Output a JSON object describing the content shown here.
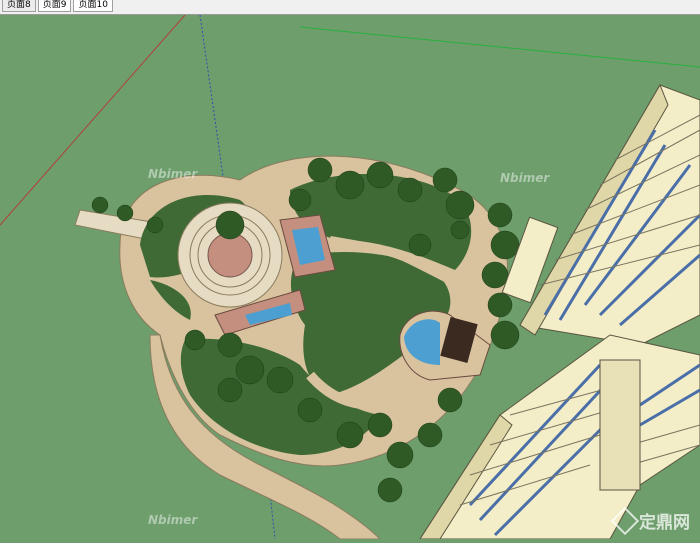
{
  "tabs": [
    {
      "label": "页面8"
    },
    {
      "label": "页面9"
    },
    {
      "label": "页面10"
    }
  ],
  "watermarks": [
    "Nbimer",
    "Nbimer",
    "Nbimer"
  ],
  "logo": {
    "text": "定鼎网"
  },
  "colors": {
    "ground": "#6d9e6c",
    "lawn": "#3f6a35",
    "path": "#d9c39e",
    "plaza": "#c48f7e",
    "building": "#f3edc8",
    "glass": "#4a6fa8",
    "tree": "#2f5a25",
    "water": "#4c9fd0"
  }
}
